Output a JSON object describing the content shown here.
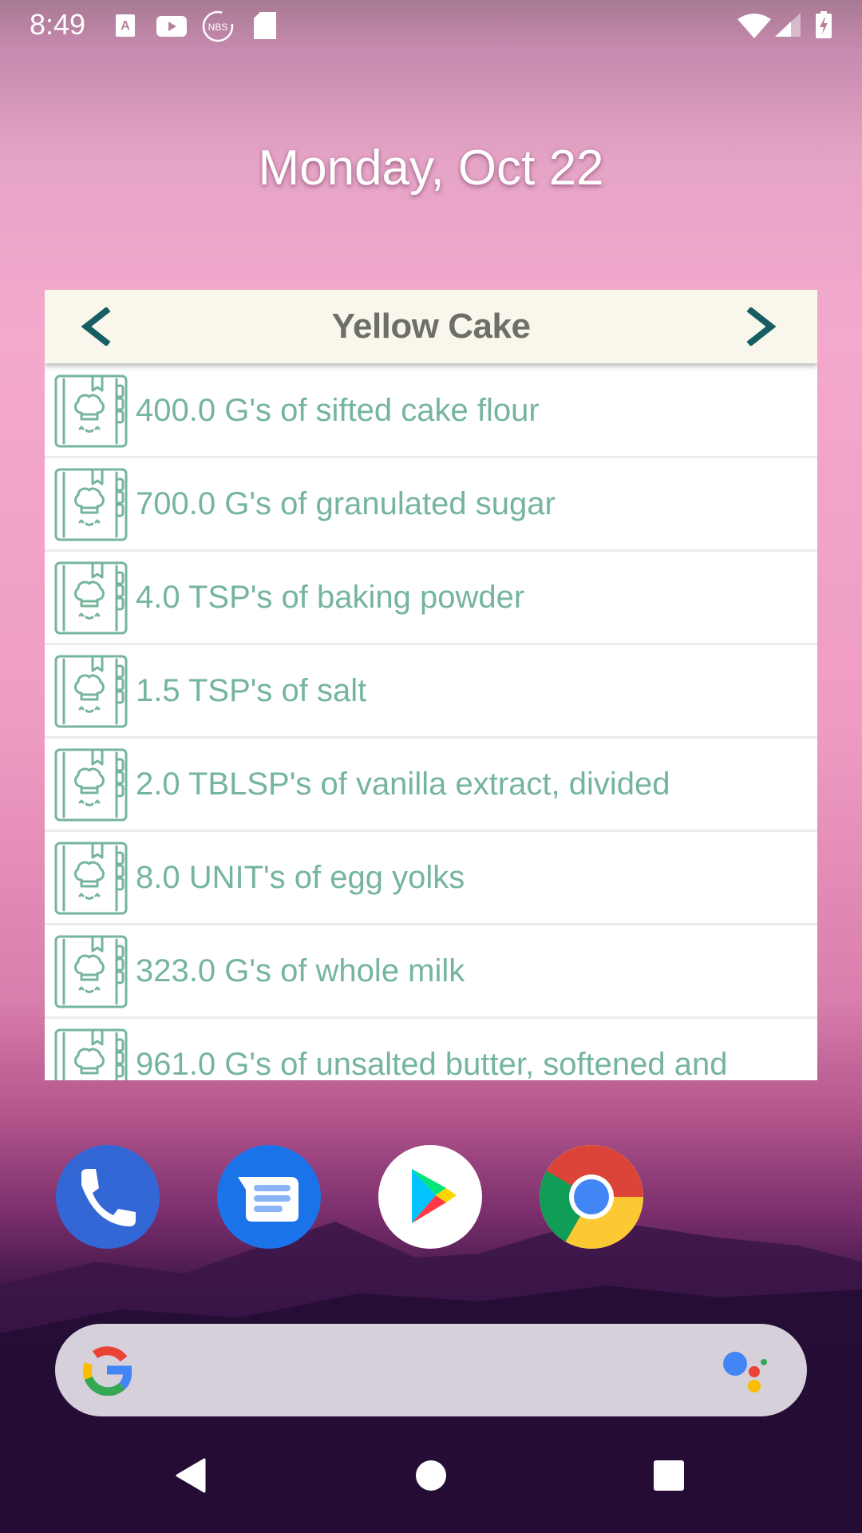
{
  "status_bar": {
    "time": "8:49",
    "left_icons": [
      "font-app-icon",
      "youtube-icon",
      "nbs-icon",
      "sd-card-icon"
    ],
    "nbs_label": "NBS",
    "right_icons": [
      "wifi-icon",
      "cell-signal-icon",
      "battery-charging-icon"
    ]
  },
  "home": {
    "date": "Monday, Oct 22"
  },
  "widget": {
    "title": "Yellow Cake",
    "prev_label": "previous recipe",
    "next_label": "next recipe",
    "row_icon": "recipe-book-icon",
    "ingredients": [
      "400.0 G's of sifted cake flour",
      "700.0 G's of granulated sugar",
      "4.0 TSP's of baking powder",
      "1.5 TSP's of salt",
      "2.0 TBLSP's of vanilla extract, divided",
      "8.0 UNIT's of egg yolks",
      "323.0 G's of whole milk",
      "961.0 G's of unsalted butter, softened and"
    ],
    "colors": {
      "header_bg": "#f9f7ec",
      "title": "#6e6f66",
      "arrow": "#175e63",
      "ingredient_text": "#75b59c"
    }
  },
  "dock": {
    "apps": [
      "Phone",
      "Messages",
      "Play Store",
      "Chrome"
    ]
  },
  "search": {
    "google_icon": "google-g-icon",
    "assistant_icon": "google-assistant-icon"
  },
  "nav_bar": {
    "buttons": [
      "back",
      "home",
      "recents"
    ]
  }
}
